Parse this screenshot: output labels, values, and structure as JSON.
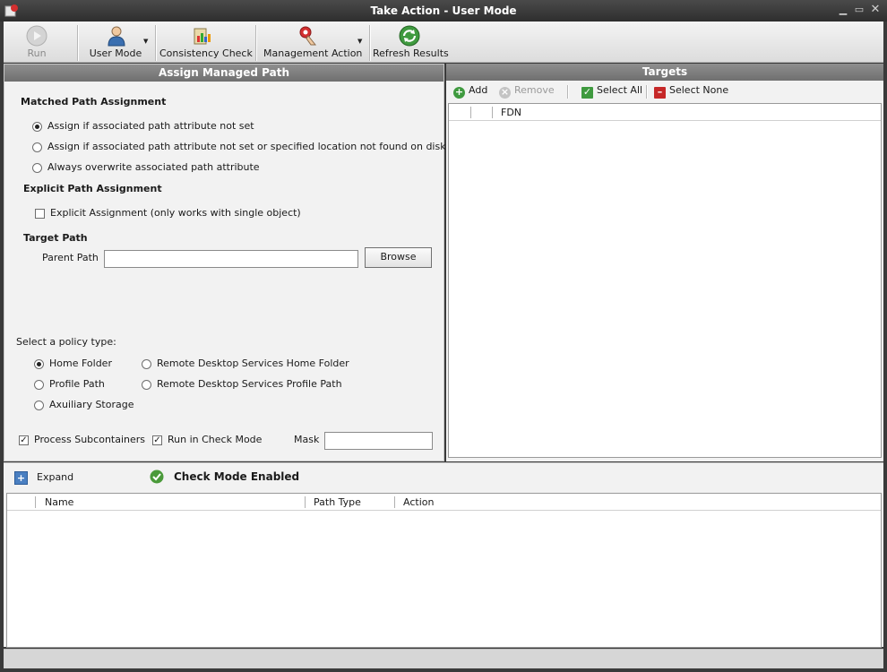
{
  "window": {
    "title": "Take Action - User Mode",
    "controls": [
      "minimize-icon",
      "maximize-icon",
      "close-icon"
    ]
  },
  "toolbar": {
    "run_label": "Run",
    "user_mode_label": "User Mode",
    "consistency_check_label": "Consistency Check",
    "management_action_label": "Management Action",
    "refresh_results_label": "Refresh Results"
  },
  "left_panel": {
    "header": "Assign Managed Path",
    "matched_title": "Matched Path Assignment",
    "matched_options": [
      "Assign if associated path attribute not set",
      "Assign if associated path attribute not set or specified location not found on disk",
      "Always overwrite associated path attribute"
    ],
    "matched_selected": 0,
    "explicit_title": "Explicit Path Assignment",
    "explicit_checkbox": "Explicit Assignment (only works with single object)",
    "explicit_checked": false,
    "target_title": "Target Path",
    "parent_path_label": "Parent Path",
    "parent_path_value": "",
    "browse_label": "Browse",
    "policy_label": "Select a policy type:",
    "policy_options": [
      "Home Folder",
      "Profile Path",
      "Axuiliary Storage",
      "Remote Desktop Services Home Folder",
      "Remote Desktop Services Profile Path"
    ],
    "policy_selected": 0,
    "process_subcontainers_label": "Process Subcontainers",
    "process_subcontainers_checked": true,
    "run_check_mode_label": "Run in Check Mode",
    "run_check_mode_checked": true,
    "mask_label": "Mask",
    "mask_value": ""
  },
  "right_panel": {
    "header": "Targets",
    "add_label": "Add",
    "remove_label": "Remove",
    "select_all_label": "Select All",
    "select_none_label": "Select None",
    "grid_columns": [
      "",
      "",
      "FDN"
    ],
    "rows": []
  },
  "results": {
    "expand_label": "Expand",
    "check_mode_label": "Check Mode Enabled",
    "columns": [
      "Name",
      "Path Type",
      "Action"
    ],
    "rows": []
  },
  "colors": {
    "panel_header": "#7c7c7c",
    "title_bar": "#3a3a3a",
    "check_ok": "#4a9a3a",
    "select_none": "#c62828"
  }
}
